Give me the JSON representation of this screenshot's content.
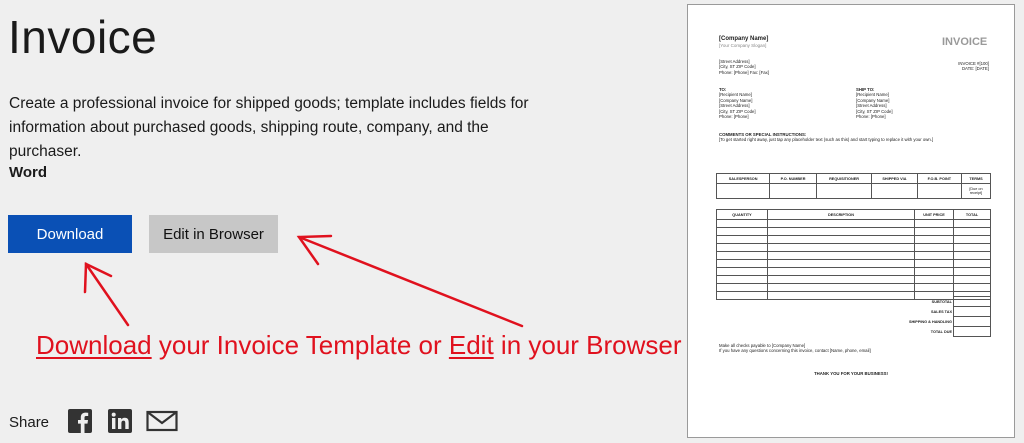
{
  "page": {
    "title": "Invoice",
    "description": "Create a professional invoice for shipped goods; template includes fields for information about purchased goods, shipping route, company, and the purchaser.",
    "app": "Word",
    "download_label": "Download",
    "edit_label": "Edit in Browser",
    "share_label": "Share"
  },
  "annotation": {
    "word1": "Download",
    "middle": " your Invoice Template or ",
    "word2": "Edit",
    "end": " in your Browser",
    "color": "#e0111e"
  },
  "share_icons": [
    "facebook-icon",
    "linkedin-icon",
    "mail-icon"
  ],
  "colors": {
    "download_button": "#0a50b5",
    "edit_button": "#c7c7c7",
    "background": "#efefef"
  },
  "preview": {
    "company": "[Company Name]",
    "slogan": "[Your Company Slogan]",
    "heading": "INVOICE",
    "address": [
      "[Street Address]",
      "[City, ST ZIP Code]",
      "Phone: [Phone]  Fax: [Fax]"
    ],
    "invoice_no": "INVOICE #[100]",
    "date": "DATE: [DATE]",
    "to_label": "TO:",
    "to": [
      "[Recipient Name]",
      "[Company Name]",
      "[Street Address]",
      "[City, ST ZIP Code]",
      "Phone: [Phone]"
    ],
    "ship_label": "SHIP TO:",
    "ship": [
      "[Recipient Name]",
      "[Company Name]",
      "[Street Address]",
      "[City, ST ZIP Code]",
      "Phone: [Phone]"
    ],
    "comments_label": "COMMENTS OR SPECIAL INSTRUCTIONS:",
    "comments": "[To get started right away, just tap any placeholder text (such as this) and start typing to replace it with your own.]",
    "order_headers": [
      "SALESPERSON",
      "P.O. NUMBER",
      "REQUISITIONER",
      "SHIPPED VIA",
      "F.O.B. POINT",
      "TERMS"
    ],
    "terms_value": "[Due on receipt]",
    "item_headers": [
      "QUANTITY",
      "DESCRIPTION",
      "UNIT PRICE",
      "TOTAL"
    ],
    "totals": [
      "SUBTOTAL",
      "SALES TAX",
      "SHIPPING & HANDLING",
      "TOTAL DUE"
    ],
    "footer1": "Make all checks payable to [Company Name]",
    "footer2": "If you have any questions concerning this invoice, contact [Name, phone, email]",
    "thanks": "THANK YOU FOR YOUR BUSINESS!"
  }
}
